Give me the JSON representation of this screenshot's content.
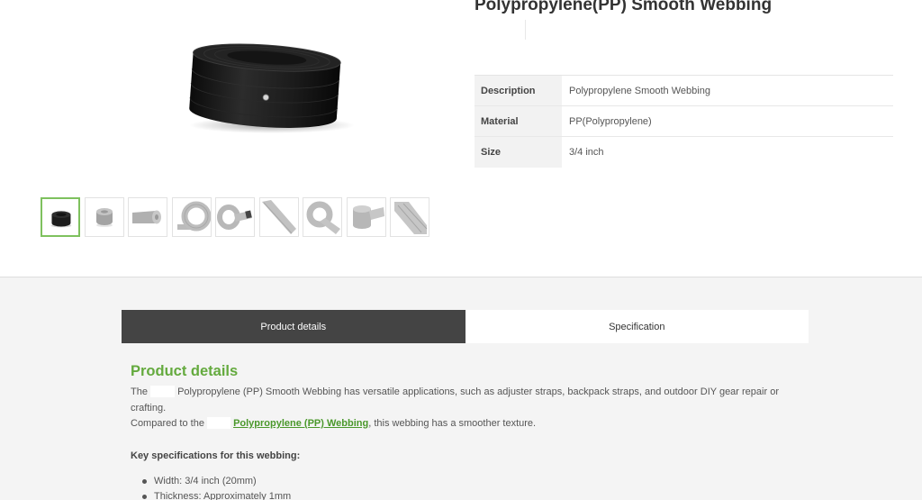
{
  "colors": {
    "accent_green": "#64aa3e",
    "link_green": "#4a982b",
    "tab_active_bg": "#444444",
    "section_bg": "#f4f4f4",
    "thumbnail_selected_border": "#7ec15e"
  },
  "product": {
    "title": "Polypropylene(PP) Smooth Webbing",
    "specs": [
      {
        "label": "Description",
        "value": "Polypropylene Smooth Webbing"
      },
      {
        "label": "Material",
        "value": "PP(Polypropylene)"
      },
      {
        "label": "Size",
        "value": "3/4 inch"
      }
    ],
    "gallery": {
      "main_image_icon": "black-webbing-roll",
      "thumbnails": [
        {
          "icon": "black-webbing-roll",
          "selected": true
        },
        {
          "icon": "gray-webbing-roll",
          "selected": false
        },
        {
          "icon": "gray-flat-roll",
          "selected": false
        },
        {
          "icon": "gray-webbing-coil",
          "selected": false
        },
        {
          "icon": "gray-strap-end",
          "selected": false
        },
        {
          "icon": "gray-strap-diagonal",
          "selected": false
        },
        {
          "icon": "gray-strap-coil",
          "selected": false
        },
        {
          "icon": "gray-roll-with-strap",
          "selected": false
        },
        {
          "icon": "gray-strap-stack",
          "selected": false
        }
      ]
    }
  },
  "tabs": [
    {
      "label": "Product details",
      "active": true
    },
    {
      "label": "Specification",
      "active": false
    }
  ],
  "product_details": {
    "heading": "Product details",
    "intro_before": "The",
    "intro_after": "Polypropylene (PP) Smooth Webbing has versatile applications, such as adjuster straps, backpack straps, and outdoor DIY gear repair or crafting.",
    "compare_before": "Compared to the",
    "compare_link": "Polypropylene (PP) Webbing",
    "compare_after": ", this webbing has a smoother texture.",
    "key_specs_heading": "Key specifications for this webbing:",
    "key_specs": [
      "Width: 3/4 inch (20mm)",
      "Thickness: Approximately 1mm"
    ]
  }
}
